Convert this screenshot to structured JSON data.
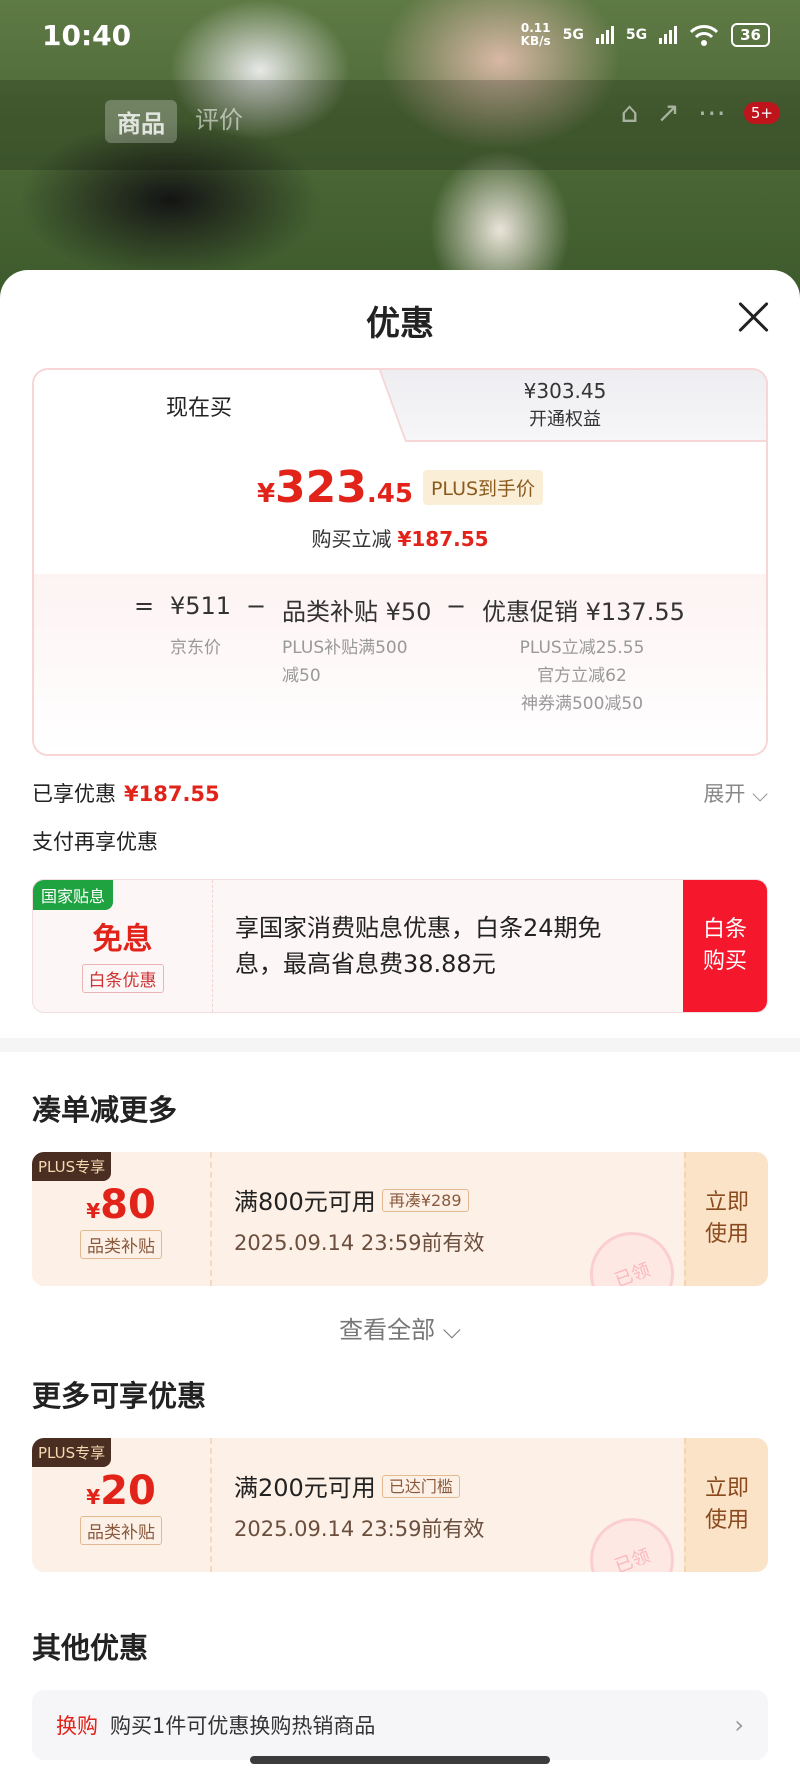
{
  "status_bar": {
    "time": "10:40",
    "net_speed_top": "0.11",
    "net_speed_bottom": "KB/s",
    "sig1": "5G",
    "sig2": "5G",
    "battery": "36"
  },
  "nav": {
    "tab_product": "商品",
    "tab_review": "评价",
    "badge": "5+"
  },
  "sheet": {
    "title": "优惠"
  },
  "price_card": {
    "tab_now": "现在买",
    "tab_plus_price": "¥303.45",
    "tab_plus_label": "开通权益",
    "currency": "¥",
    "price_int": "323",
    "price_dec": ".45",
    "plus_tag": "PLUS到手价",
    "reduce_label": "购买立减",
    "reduce_value": "¥187.55",
    "formula": {
      "eq": "=",
      "base": "¥511",
      "minus1": "−",
      "cat_sub": "品类补贴 ¥50",
      "minus2": "−",
      "promo": "优惠促销 ¥137.55",
      "base_label": "京东价",
      "cat_sub_line1": "PLUS补贴满500",
      "cat_sub_line2": "减50",
      "promo_line1": "PLUS立减25.55",
      "promo_line2": "官方立减62",
      "promo_line3": "神券满500减50"
    }
  },
  "enjoyed": {
    "label": "已享优惠",
    "value": "¥187.55",
    "expand": "展开 ⌵"
  },
  "pay_more": "支付再享优惠",
  "baitiao": {
    "tag": "国家贴息",
    "title": "免息",
    "sub": "白条优惠",
    "text": "享国家消费贴息优惠，白条24期免息，最高省息费38.88元",
    "btn": "白条购买"
  },
  "section_more": "凑单减更多",
  "coupon1": {
    "tag": "PLUS专享",
    "currency": "¥",
    "amount": "80",
    "sub": "品类补贴",
    "cond": "满800元可用",
    "chip": "再凑¥289",
    "date": "2025.09.14 23:59前有效",
    "btn": "立即使用",
    "stamp": "已领"
  },
  "view_all": "查看全部 ⌵",
  "section_extra": "更多可享优惠",
  "coupon2": {
    "tag": "PLUS专享",
    "currency": "¥",
    "amount": "20",
    "sub": "品类补贴",
    "cond": "满200元可用",
    "chip": "已达门槛",
    "date": "2025.09.14 23:59前有效",
    "btn": "立即使用",
    "stamp": "已领"
  },
  "section_other": "其他优惠",
  "other": {
    "tag": "换购",
    "text": "购买1件可优惠换购热销商品",
    "chev": "›"
  },
  "colors": {
    "red": "#e2231a",
    "green_tag": "#1fa340",
    "btn_red": "#f5172c",
    "coupon_bg": "#fdf0e6"
  }
}
